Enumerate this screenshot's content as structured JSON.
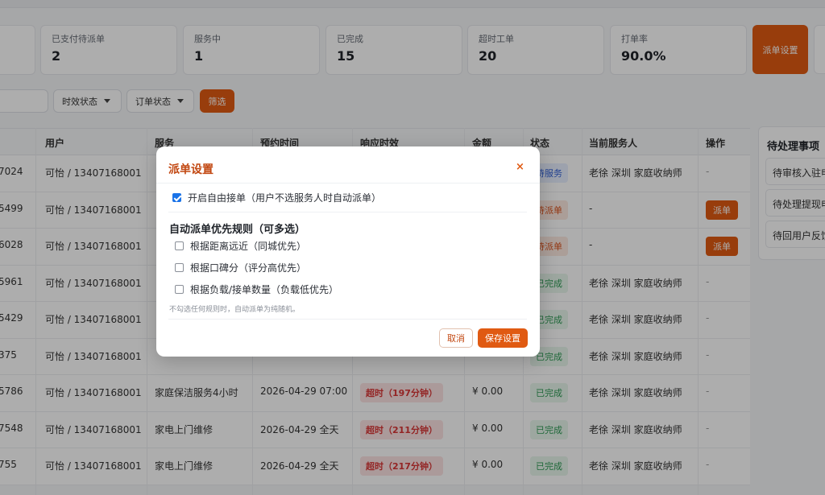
{
  "stats": [
    {
      "label": "已支付待派单",
      "value": "2"
    },
    {
      "label": "服务中",
      "value": "1"
    },
    {
      "label": "已完成",
      "value": "15"
    },
    {
      "label": "超时工单",
      "value": "20"
    },
    {
      "label": "打单率",
      "value": "90.0%"
    }
  ],
  "dispatch_settings_label": "派单设置",
  "filters": {
    "time_status": "时效状态",
    "order_status": "订单状态",
    "filter_button": "筛选"
  },
  "table": {
    "headers": [
      "用户",
      "服务",
      "预约时间",
      "响应时效",
      "金额",
      "状态",
      "当前服务人",
      "操作"
    ],
    "rows": [
      {
        "id": "7024",
        "user": "可怡 / 13407168001",
        "service": "",
        "time": "",
        "response": "",
        "amount": "",
        "status": "待服务",
        "status_kind": "svc",
        "staff": "老徐 深圳 家庭收纳师",
        "action": "-"
      },
      {
        "id": "5499",
        "user": "可怡 / 13407168001",
        "service": "",
        "time": "",
        "response": "",
        "amount": "",
        "status": "待派单",
        "status_kind": "wait",
        "staff": "-",
        "action": "派单"
      },
      {
        "id": "6028",
        "user": "可怡 / 13407168001",
        "service": "",
        "time": "",
        "response": "",
        "amount": "",
        "status": "待派单",
        "status_kind": "wait",
        "staff": "-",
        "action": "派单"
      },
      {
        "id": "5961",
        "user": "可怡 / 13407168001",
        "service": "",
        "time": "",
        "response": "",
        "amount": "",
        "status": "已完成",
        "status_kind": "done",
        "staff": "老徐 深圳 家庭收纳师",
        "action": "-"
      },
      {
        "id": "5429",
        "user": "可怡 / 13407168001",
        "service": "",
        "time": "",
        "response": "",
        "amount": "",
        "status": "已完成",
        "status_kind": "done",
        "staff": "老徐 深圳 家庭收纳师",
        "action": "-"
      },
      {
        "id": "375",
        "user": "可怡 / 13407168001",
        "service": "",
        "time": "",
        "response": "",
        "amount": "",
        "status": "已完成",
        "status_kind": "done",
        "staff": "老徐 深圳 家庭收纳师",
        "action": "-"
      },
      {
        "id": "5786",
        "user": "可怡 / 13407168001",
        "service": "家庭保洁服务4小时",
        "time": "2026-04-29 07:00",
        "response": "超时（197分钟）",
        "amount": "¥ 0.00",
        "status": "已完成",
        "status_kind": "done",
        "staff": "老徐 深圳 家庭收纳师",
        "action": "-"
      },
      {
        "id": "7548",
        "user": "可怡 / 13407168001",
        "service": "家电上门维修",
        "time": "2026-04-29 全天",
        "response": "超时（211分钟）",
        "amount": "¥ 0.00",
        "status": "已完成",
        "status_kind": "done",
        "staff": "老徐 深圳 家庭收纳师",
        "action": "-"
      },
      {
        "id": "755",
        "user": "可怡 / 13407168001",
        "service": "家电上门维修",
        "time": "2026-04-29 全天",
        "response": "超时（217分钟）",
        "amount": "¥ 0.00",
        "status": "已完成",
        "status_kind": "done",
        "staff": "老徐 深圳 家庭收纳师",
        "action": "-"
      }
    ]
  },
  "pending": {
    "title": "待处理事项",
    "items": [
      "待审核入驻申",
      "待处理提现申",
      "待回用户反馈"
    ]
  },
  "modal": {
    "title": "派单设置",
    "close": "×",
    "free_accept_label": "开启自由接单（用户不选服务人时自动派单）",
    "free_accept_checked": true,
    "rules_title": "自动派单优先规则（可多选）",
    "rules": [
      {
        "label": "根据距离远近（同城优先）",
        "checked": false
      },
      {
        "label": "根据口碑分（评分高优先）",
        "checked": false
      },
      {
        "label": "根据负载/接单数量（负载低优先）",
        "checked": false
      }
    ],
    "hint": "不勾选任何规则时，自动派单为纯随机。",
    "cancel": "取消",
    "save": "保存设置"
  }
}
